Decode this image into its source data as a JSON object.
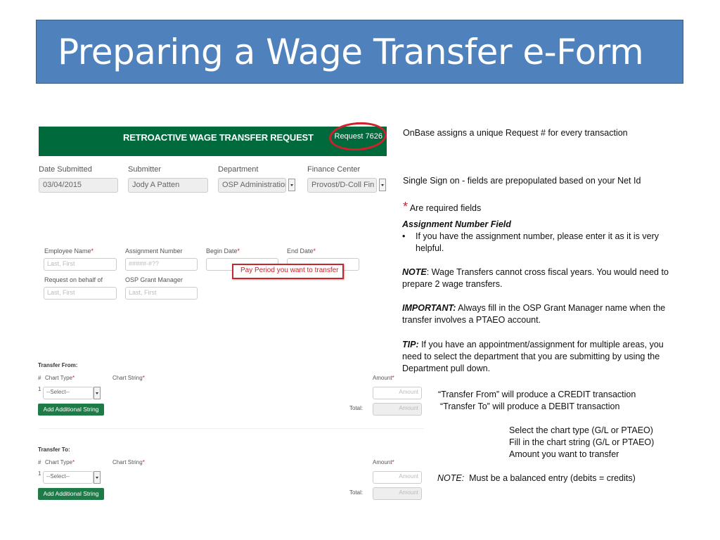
{
  "slide": {
    "title": "Preparing a Wage Transfer e-Form"
  },
  "form": {
    "header_title": "RETROACTIVE WAGE TRANSFER REQUEST",
    "request_number": "Request 7626",
    "top_fields": [
      {
        "label": "Date Submitted",
        "value": "03/04/2015"
      },
      {
        "label": "Submitter",
        "value": "Jody A Patten"
      },
      {
        "label": "Department",
        "value": "OSP Administration"
      },
      {
        "label": "Finance Center",
        "value": "Provost/D-Coll Fin Ct"
      }
    ],
    "employee_name_label": "Employee Name",
    "employee_name_placeholder": "Last, First",
    "assignment_number_label": "Assignment Number",
    "assignment_number_placeholder": "#####-#??",
    "begin_date_label": "Begin Date",
    "end_date_label": "End Date",
    "request_on_behalf_label": "Request on behalf of",
    "request_on_behalf_placeholder": "Last, First",
    "osp_grant_manager_label": "OSP Grant Manager",
    "osp_grant_manager_placeholder": "Last, First",
    "callout_text": "Pay Period you want to transfer",
    "required_marker": "*",
    "transfer_from": {
      "heading": "Transfer From:",
      "col_num": "#",
      "col_chart_type": "Chart Type",
      "col_chart_string": "Chart String",
      "col_amount": "Amount",
      "row_num": "1",
      "select_value": "--Select--",
      "amount_placeholder": "Amount",
      "add_button": "Add Additional String",
      "total_label": "Total:",
      "total_placeholder": "Amount"
    },
    "transfer_to": {
      "heading": "Transfer To:",
      "col_num": "#",
      "col_chart_type": "Chart Type",
      "col_chart_string": "Chart String",
      "col_amount": "Amount",
      "row_num": "1",
      "select_value": "--Select--",
      "amount_placeholder": "Amount",
      "add_button": "Add Additional String",
      "total_label": "Total:",
      "total_placeholder": "Amount"
    }
  },
  "notes": {
    "onbase": "OnBase assigns a unique Request # for every transaction",
    "single_sign_on": "Single Sign on - fields are prepopulated based on your Net Id",
    "required_star": "*",
    "required_text": "Are required fields",
    "assignment_heading": "Assignment Number Field",
    "assignment_bullet": "If you have the assignment number, please enter it as it is very helpful.",
    "note1_label": "NOTE",
    "note1_text": ": Wage Transfers cannot cross fiscal years.  You would need to prepare 2 wage transfers.",
    "important_label": "IMPORTANT:",
    "important_text": " Always fill in the OSP Grant Manager name when the transfer involves a PTAEO account.",
    "tip_label": "TIP:",
    "tip_text": " If you have an appointment/assignment for multiple areas, you need to select the department that you are submitting by using the Department pull down.",
    "transfer_from_note": "“Transfer From” will produce a CREDIT transaction",
    "transfer_to_note": "“Transfer To” will produce a DEBIT transaction",
    "steps": [
      "Select the chart type (G/L or PTAEO)",
      "Fill in the chart string (G/L or PTAEO)",
      "Amount you want to transfer"
    ],
    "note2_label": "NOTE:",
    "note2_text": "  Must be a balanced entry (debits = credits)"
  }
}
